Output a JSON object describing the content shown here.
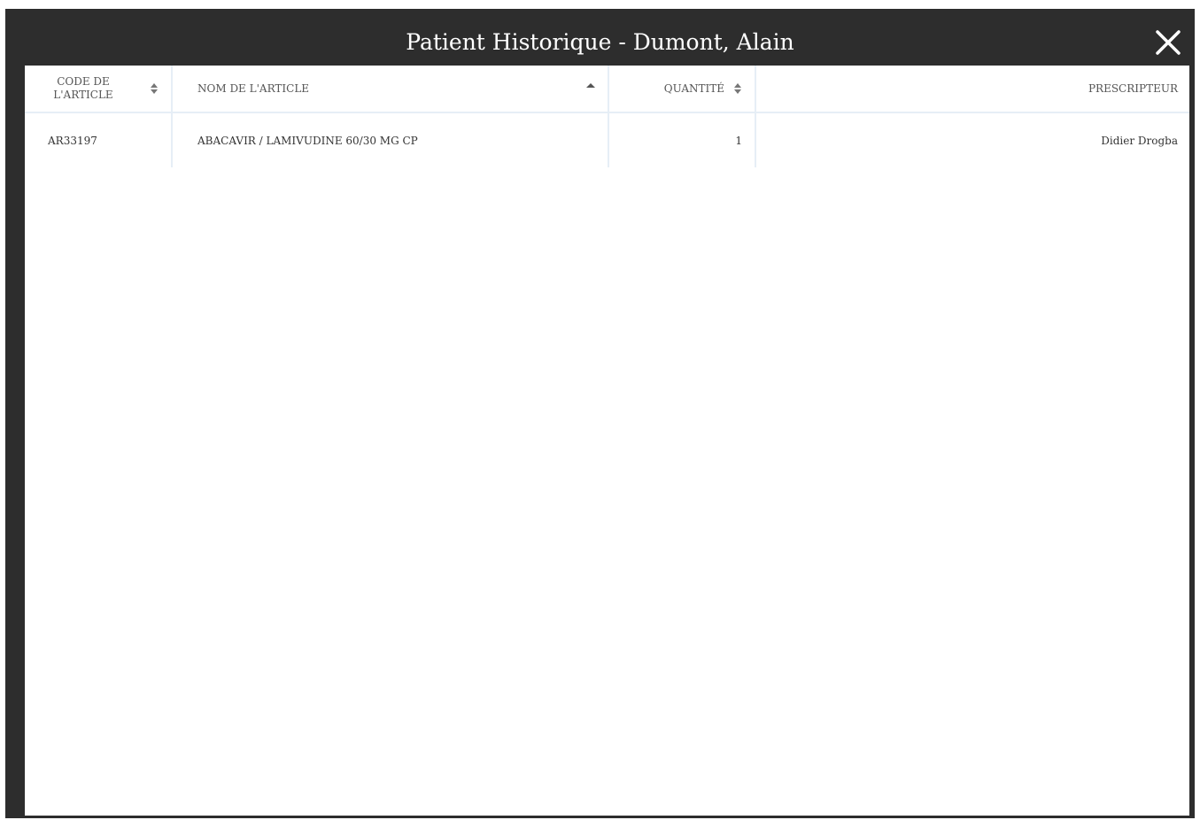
{
  "dialog": {
    "title": "Patient Historique - Dumont, Alain",
    "close_icon": "close-icon"
  },
  "table": {
    "columns": [
      {
        "label": "CODE DE L'ARTICLE",
        "sort": "both"
      },
      {
        "label": "NOM DE L'ARTICLE",
        "sort": "asc"
      },
      {
        "label": "QUANTITÉ",
        "sort": "both"
      },
      {
        "label": "PRESCRIPTEUR",
        "sort": "none"
      }
    ],
    "rows": [
      {
        "code": "AR33197",
        "name": "ABACAVIR / LAMIVUDINE 60/30 MG CP",
        "quantity": "1",
        "prescriber": "Didier Drogba"
      }
    ]
  },
  "colors": {
    "header_bg": "#2d2d2d",
    "body_bg": "#ffffff",
    "grid_line": "#e6eef6"
  }
}
